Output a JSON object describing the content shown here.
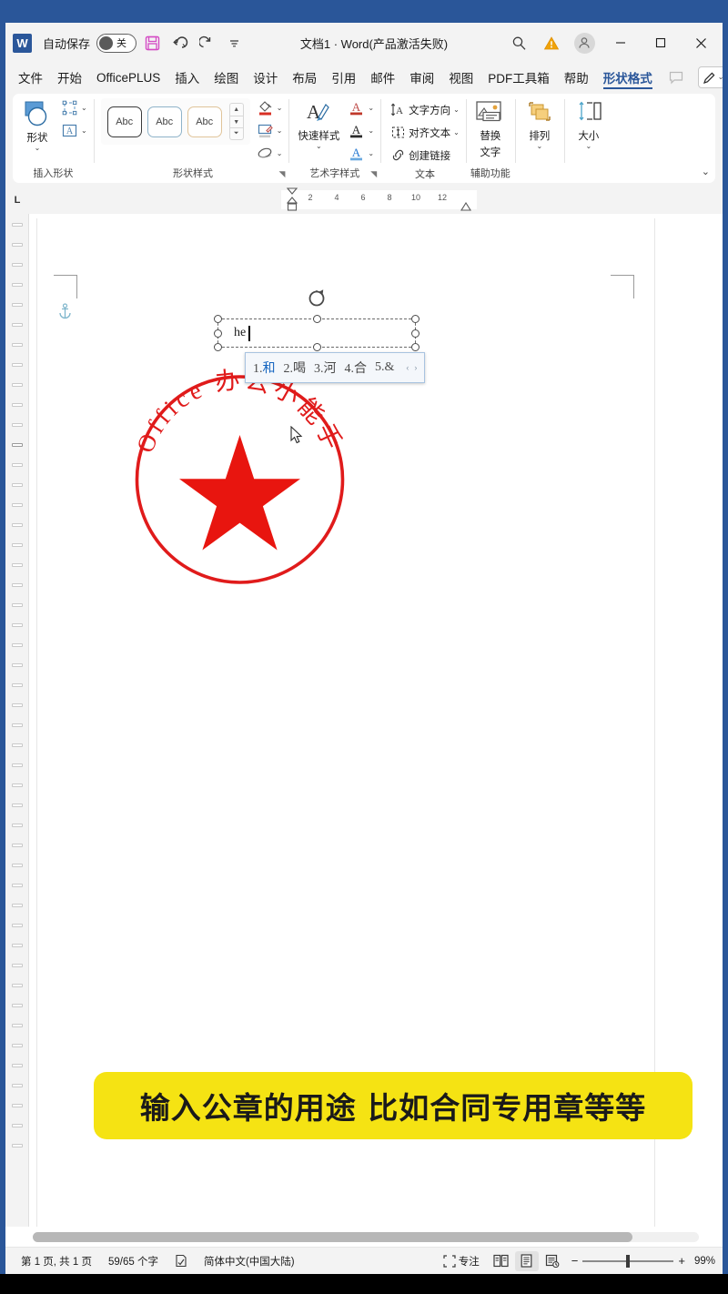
{
  "window": {
    "app_icon": "word-icon",
    "app_icon_letter": "W",
    "autosave_label": "自动保存",
    "autosave_state": "关",
    "title": "文档1 · Word(产品激活失败)",
    "qat": [
      {
        "name": "save-icon",
        "glyph": "save"
      },
      {
        "name": "undo-icon",
        "glyph": "undo"
      },
      {
        "name": "redo-icon",
        "glyph": "redo"
      },
      {
        "name": "customize-qat-icon",
        "glyph": "chevron-down"
      }
    ],
    "controls": {
      "search": "search-icon",
      "warning": "warning-icon",
      "account": "account-avatar-icon",
      "minimize": "—",
      "maximize": "☐",
      "close": "✕"
    }
  },
  "tabs": [
    {
      "label": "文件",
      "active": false
    },
    {
      "label": "开始",
      "active": false
    },
    {
      "label": "OfficePLUS",
      "active": false
    },
    {
      "label": "插入",
      "active": false
    },
    {
      "label": "绘图",
      "active": false
    },
    {
      "label": "设计",
      "active": false
    },
    {
      "label": "布局",
      "active": false
    },
    {
      "label": "引用",
      "active": false
    },
    {
      "label": "邮件",
      "active": false
    },
    {
      "label": "审阅",
      "active": false
    },
    {
      "label": "视图",
      "active": false
    },
    {
      "label": "PDF工具箱",
      "active": false
    },
    {
      "label": "帮助",
      "active": false
    },
    {
      "label": "形状格式",
      "active": true
    }
  ],
  "tabbar_right": {
    "comment_icon": "comment-icon",
    "pen_label": "",
    "share_label": ""
  },
  "ribbon": {
    "groups": [
      {
        "label": "插入形状",
        "big": {
          "label": "形状",
          "icon": "shapes-icon"
        },
        "small": [
          {
            "label": "",
            "icon": "edit-shape-icon"
          },
          {
            "label": "",
            "icon": "text-box-icon"
          }
        ]
      },
      {
        "label": "形状样式",
        "swatches": [
          {
            "text": "Abc",
            "border": "#3a3a3a"
          },
          {
            "text": "Abc",
            "border": "#8fb3c9"
          },
          {
            "text": "Abc",
            "border": "#e0c49a"
          }
        ],
        "small": [
          {
            "label": "",
            "icon": "shape-fill-icon"
          },
          {
            "label": "",
            "icon": "shape-outline-icon"
          },
          {
            "label": "",
            "icon": "shape-effects-icon"
          }
        ]
      },
      {
        "label": "艺术字样式",
        "big": {
          "label": "快速样式",
          "icon": "wordart-quick-styles-icon"
        },
        "small": [
          {
            "label": "",
            "icon": "text-fill-icon"
          },
          {
            "label": "",
            "icon": "text-outline-icon"
          },
          {
            "label": "",
            "icon": "text-effects-icon"
          }
        ]
      },
      {
        "label": "文本",
        "rows": [
          {
            "label": "文字方向",
            "icon": "text-direction-icon",
            "caret": true
          },
          {
            "label": "对齐文本",
            "icon": "align-text-icon",
            "caret": true
          },
          {
            "label": "创建链接",
            "icon": "create-link-icon",
            "caret": false
          }
        ]
      },
      {
        "label": "辅助功能",
        "big": {
          "label": "替换\n文字",
          "label1": "替换",
          "label2": "文字",
          "icon": "alt-text-icon"
        }
      },
      {
        "label": "",
        "big": {
          "label": "排列",
          "icon": "arrange-icon"
        }
      },
      {
        "label": "",
        "big": {
          "label": "大小",
          "icon": "size-icon"
        }
      }
    ]
  },
  "ruler": {
    "tab_selector": "L",
    "numbers": [
      "2",
      "4",
      "6",
      "8",
      "10",
      "12"
    ]
  },
  "document": {
    "shape": {
      "typed_text": "he",
      "name": "selected-text-box"
    },
    "ime": {
      "candidates": [
        {
          "index": "1.",
          "word": "和",
          "selected": true
        },
        {
          "index": "2.",
          "word": "喝",
          "selected": false
        },
        {
          "index": "3.",
          "word": "河",
          "selected": false
        },
        {
          "index": "4.",
          "word": "合",
          "selected": false
        },
        {
          "index": "5.",
          "word": "&",
          "selected": false
        }
      ],
      "prev_arrow": "‹",
      "next_arrow": "›"
    },
    "stamp": {
      "arc_text": "Office 办公小能手",
      "ring_color": "#e01b1b",
      "star_color": "#e8150f"
    }
  },
  "caption": {
    "text": "输入公章的用途 比如合同专用章等等",
    "background": "#f5e313"
  },
  "statusbar": {
    "page_info": "第 1 页, 共 1 页",
    "word_count": "59/65 个字",
    "proofing_icon": "proofing-icon",
    "language": "简体中文(中国大陆)",
    "focus_label": "专注",
    "focus_icon": "focus-icon",
    "view_read_icon": "read-mode-icon",
    "view_print_icon": "print-layout-icon",
    "view_web_icon": "web-layout-icon",
    "zoom_out": "−",
    "zoom_in": "+",
    "zoom_level": "99%"
  }
}
